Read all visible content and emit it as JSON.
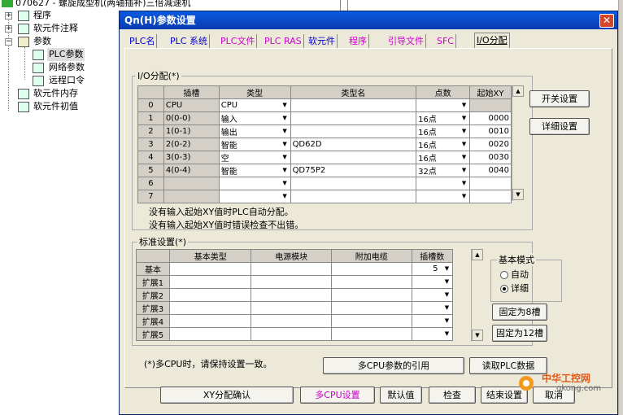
{
  "tree": {
    "top_text": "070627 - 螺旋成型机(两轴插补)三倍减速机",
    "items": [
      {
        "label": "程序"
      },
      {
        "label": "软元件注释"
      },
      {
        "label": "参数"
      },
      {
        "label": "PLC参数"
      },
      {
        "label": "网络参数"
      },
      {
        "label": "远程口令"
      },
      {
        "label": "软元件内存"
      },
      {
        "label": "软元件初值"
      }
    ]
  },
  "dialog": {
    "title": "Qn(H)参数设置",
    "tabs": [
      "PLC名",
      "PLC 系统",
      "PLC文件",
      "PLC RAS",
      "软元件",
      "程序",
      "引导文件",
      "SFC",
      "I/O分配"
    ],
    "active_tab": "I/O分配",
    "io_group_label": "I/O分配(*)",
    "io_headers": [
      "插槽",
      "类型",
      "类型名",
      "点数",
      "起始XY"
    ],
    "io_rows": [
      {
        "no": "0",
        "slot": "CPU",
        "type": "CPU",
        "model": "",
        "points": "",
        "start": ""
      },
      {
        "no": "1",
        "slot": "0(0-0)",
        "type": "输入",
        "model": "",
        "points": "16点",
        "start": "0000"
      },
      {
        "no": "2",
        "slot": "1(0-1)",
        "type": "输出",
        "model": "",
        "points": "16点",
        "start": "0010"
      },
      {
        "no": "3",
        "slot": "2(0-2)",
        "type": "智能",
        "model": "QD62D",
        "points": "16点",
        "start": "0020"
      },
      {
        "no": "4",
        "slot": "3(0-3)",
        "type": "空",
        "model": "",
        "points": "16点",
        "start": "0030"
      },
      {
        "no": "5",
        "slot": "4(0-4)",
        "type": "智能",
        "model": "QD75P2",
        "points": "32点",
        "start": "0040"
      },
      {
        "no": "6",
        "slot": "",
        "type": "",
        "model": "",
        "points": "",
        "start": ""
      },
      {
        "no": "7",
        "slot": "",
        "type": "",
        "model": "",
        "points": "",
        "start": ""
      }
    ],
    "switch_setting": "开关设置",
    "detail_setting": "详细设置",
    "note1": "没有输入起始XY值时PLC自动分配。",
    "note2": "没有输入起始XY值时错误检查不出错。",
    "std_group_label": "标准设置(*)",
    "std_headers": [
      "基本类型",
      "电源模块",
      "附加电缆",
      "插槽数"
    ],
    "std_rows": [
      {
        "name": "基本",
        "slots": "5"
      },
      {
        "name": "扩展1",
        "slots": ""
      },
      {
        "name": "扩展2",
        "slots": ""
      },
      {
        "name": "扩展3",
        "slots": ""
      },
      {
        "name": "扩展4",
        "slots": ""
      },
      {
        "name": "扩展5",
        "slots": ""
      }
    ],
    "basic_mode_label": "基本模式",
    "mode_auto": "自动",
    "mode_detail": "详细",
    "fix8": "固定为8槽",
    "fix12": "固定为12槽",
    "multicpu_note": "(*)多CPU时，请保持设置一致。",
    "multicpu_ref": "多CPU参数的引用",
    "read_plc": "读取PLC数据",
    "bottom_buttons": [
      "XY分配确认",
      "多CPU设置",
      "默认值",
      "检查",
      "结束设置",
      "取消"
    ]
  },
  "watermark": {
    "line1": "中华工控网",
    "line2": "gkong.com"
  },
  "colors": {
    "titlebar": "#0a3bb0",
    "magenta": "#cc00cc",
    "dialog_bg": "#ece9d8"
  }
}
